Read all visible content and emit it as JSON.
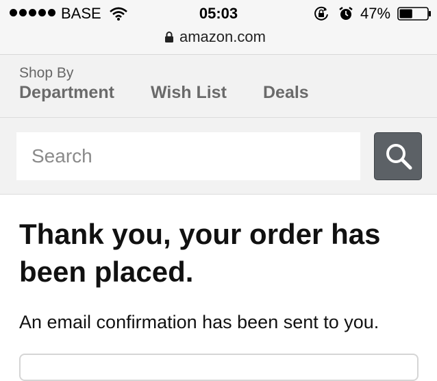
{
  "status_bar": {
    "carrier": "BASE",
    "time": "05:03",
    "battery_percent": "47%",
    "battery_level": 0.47,
    "signal_bars": 5,
    "icons": [
      "wifi-icon",
      "rotation-lock-icon",
      "alarm-icon",
      "battery-icon"
    ]
  },
  "browser": {
    "url": "amazon.com",
    "secure_icon": "lock-icon"
  },
  "nav": {
    "shop_by_label": "Shop By",
    "department_label": "Department",
    "wish_list_label": "Wish List",
    "deals_label": "Deals"
  },
  "search": {
    "placeholder": "Search",
    "value": "",
    "button_icon": "search-icon"
  },
  "main": {
    "title": "Thank you, your order has been placed.",
    "message": "An email confirmation has been sent to you."
  },
  "colors": {
    "status_bar_bg": "#f6f6f6",
    "nav_bg": "#f2f2f2",
    "nav_text": "#6a6a6a",
    "search_button_bg": "#5c6166"
  }
}
